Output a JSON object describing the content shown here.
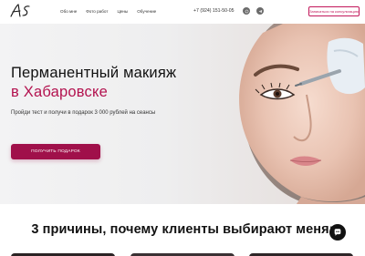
{
  "header": {
    "logo_text": "AS",
    "nav": [
      {
        "label": "Обо мне"
      },
      {
        "label": "Фото работ"
      },
      {
        "label": "Цены"
      },
      {
        "label": "Обучение"
      }
    ],
    "phone": "+7 (924) 151-50-05",
    "socials": [
      {
        "icon": "whatsapp-icon"
      },
      {
        "icon": "telegram-icon"
      }
    ],
    "cta_label": "Записаться на консультацию"
  },
  "hero": {
    "title_line1": "Перманентный макияж",
    "title_line2": "в Хабаровске",
    "subtitle": "Пройди тест и получи в подарок 3 000 рублей на сеансы",
    "button_label": "ПОЛУЧИТЬ ПОДАРОК"
  },
  "reasons": {
    "title": "3 причины, почему клиенты выбирают меня:"
  },
  "chat": {
    "icon": "chat-icon"
  },
  "colors": {
    "accent": "#b3124f",
    "button": "#a0104a",
    "text": "#111111"
  }
}
